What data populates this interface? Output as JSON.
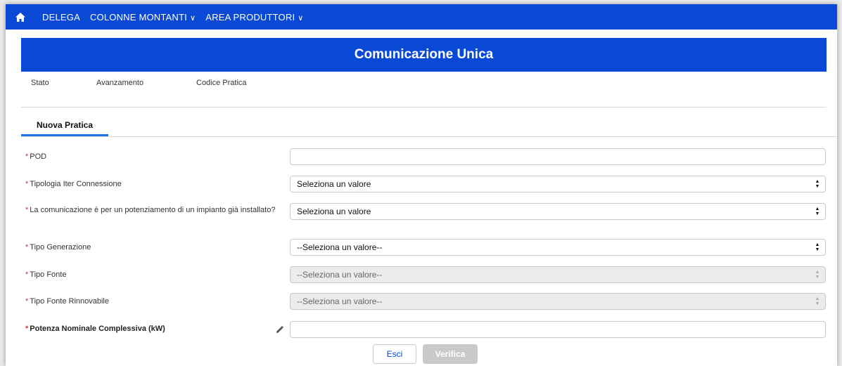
{
  "nav": {
    "items": [
      {
        "label": "DELEGA",
        "has_chevron": false
      },
      {
        "label": "COLONNE MONTANTI",
        "has_chevron": true
      },
      {
        "label": "AREA PRODUTTORI",
        "has_chevron": true
      }
    ],
    "chevron_glyph": "∨"
  },
  "header": {
    "title": "Comunicazione Unica"
  },
  "meta": {
    "stato": "Stato",
    "avanzamento": "Avanzamento",
    "codice_pratica": "Codice Pratica"
  },
  "tab": {
    "label": "Nuova Pratica"
  },
  "form": {
    "required_mark": "*",
    "pod": {
      "label": "POD",
      "value": ""
    },
    "tipologia": {
      "label": "Tipologia Iter Connessione",
      "value": "Seleziona un valore"
    },
    "potenziamento": {
      "label": "La comunicazione è per un potenziamento di un impianto già installato?",
      "value": "Seleziona un valore"
    },
    "tipo_generazione": {
      "label": "Tipo Generazione",
      "value": "--Seleziona un valore--"
    },
    "tipo_fonte": {
      "label": "Tipo Fonte",
      "value": "--Seleziona un valore--"
    },
    "tipo_fonte_rinnovabile": {
      "label": "Tipo Fonte Rinnovabile",
      "value": "--Seleziona un valore--"
    },
    "potenza": {
      "label": "Potenza Nominale Complessiva (kW)",
      "value": ""
    }
  },
  "buttons": {
    "esci": "Esci",
    "verifica": "Verifica"
  },
  "colors": {
    "brand_blue": "#0a49d6",
    "tab_accent": "#1a73e8",
    "required": "#c23934"
  }
}
